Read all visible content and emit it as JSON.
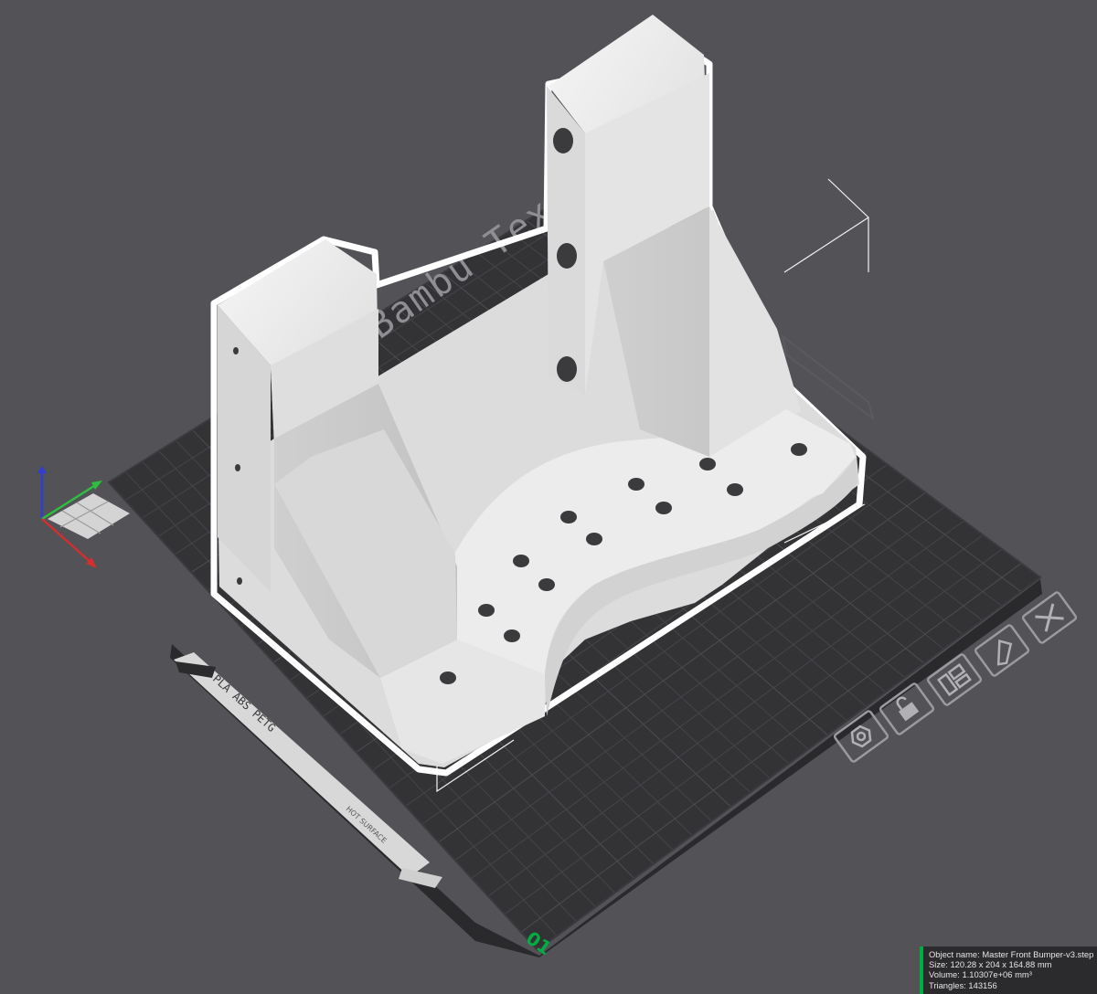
{
  "plate": {
    "texture_label": "Bambu Textured",
    "plate_number": "01",
    "filament_label": "PLA ABS PETG",
    "hot_surface_label": "HOT SURFACE"
  },
  "plate_tools": [
    {
      "name": "close-plate-icon"
    },
    {
      "name": "auto-orient-icon"
    },
    {
      "name": "arrange-icon"
    },
    {
      "name": "lock-plate-icon"
    },
    {
      "name": "plate-settings-icon"
    }
  ],
  "object_info": {
    "object_name": "Object name: Master Front Bumper-v3.step",
    "size": "Size: 120.28 x 204 x 164.88 mm",
    "volume": "Volume: 1.10307e+06 mm³",
    "triangles": "Triangles: 143156"
  },
  "colors": {
    "background": "#525257",
    "plate": "#333336",
    "grid": "#45454a",
    "accent_green": "#00ae42",
    "model": "#e9e9e9",
    "axis_x": "#d22f2f",
    "axis_y": "#2fbf3f",
    "axis_z": "#2f3fd2"
  }
}
